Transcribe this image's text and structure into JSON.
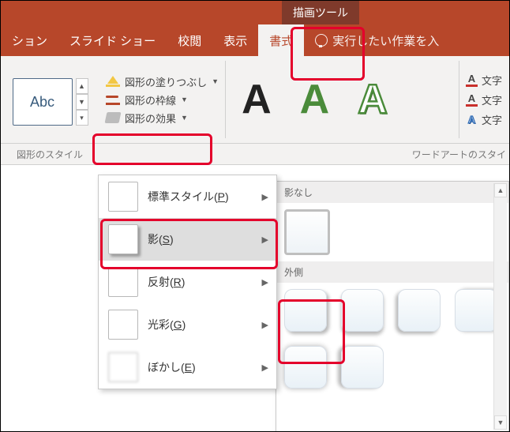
{
  "context_tab": "描画ツール",
  "tabs": {
    "transition": "ション",
    "slideshow": "スライド ショー",
    "review": "校閲",
    "view": "表示",
    "format": "書式",
    "tellme": "実行したい作業を入"
  },
  "shape_group": {
    "abc": "Abc",
    "fill": "図形の塗りつぶし",
    "outline": "図形の枠線",
    "effects": "図形の効果",
    "group_label": "図形のスタイル",
    "wordart_label": "ワードアートのスタイ"
  },
  "text_cmds": {
    "a": "文字",
    "b": "文字",
    "c": "文字"
  },
  "fx_menu": {
    "preset": "標準スタイル",
    "preset_key": "P",
    "shadow": "影",
    "shadow_key": "S",
    "reflection": "反射",
    "reflection_key": "R",
    "glow": "光彩",
    "glow_key": "G",
    "soft": "ぼかし",
    "soft_key": "E"
  },
  "shadow_menu": {
    "none": "影なし",
    "outer": "外側"
  }
}
